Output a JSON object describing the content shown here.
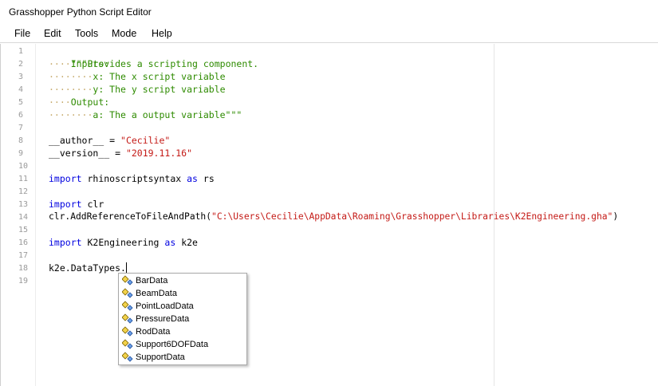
{
  "window": {
    "title": "Grasshopper Python Script Editor"
  },
  "menu": [
    "File",
    "Edit",
    "Tools",
    "Mode",
    "Help"
  ],
  "line_numbers": [
    "1",
    "2",
    "3",
    "4",
    "5",
    "6",
    "7",
    "8",
    "9",
    "10",
    "11",
    "12",
    "13",
    "14",
    "15",
    "16",
    "17",
    "18",
    "19"
  ],
  "code": {
    "l1": "\"\"\"Provides a scripting component.",
    "l2_dots": "····",
    "l2_text": "Inputs:",
    "l3_dots": "········",
    "l3_text": "x: The x script variable",
    "l4_dots": "········",
    "l4_text": "y: The y script variable",
    "l5_dots": "····",
    "l5_text": "Output:",
    "l6_dots": "········",
    "l6_text": "a: The a output variable\"\"\"",
    "l8_name": "__author__ = ",
    "l8_val": "\"Cecilie\"",
    "l9_name": "__version__ = ",
    "l9_val": "\"2019.11.16\"",
    "l11_kw1": "import",
    "l11_mod": " rhinoscriptsyntax ",
    "l11_kw2": "as",
    "l11_alias": " rs",
    "l13_kw": "import",
    "l13_mod": " clr",
    "l14_call": "clr.AddReferenceToFileAndPath(",
    "l14_str": "\"C:\\Users\\Cecilie\\AppData\\Roaming\\Grasshopper\\Libraries\\K2Engineering.gha\"",
    "l14_close": ")",
    "l16_kw1": "import",
    "l16_mod": " K2Engineering ",
    "l16_kw2": "as",
    "l16_alias": " k2e",
    "l18": "k2e.DataTypes."
  },
  "autocomplete": {
    "icon": "class-icon",
    "items": [
      "BarData",
      "BeamData",
      "PointLoadData",
      "PressureData",
      "RodData",
      "Support6DOFData",
      "SupportData"
    ]
  },
  "colors": {
    "comment": "#2e8b00",
    "keyword": "#0000e0",
    "string": "#c41a16",
    "whitespace_dots": "#c6a96a"
  }
}
